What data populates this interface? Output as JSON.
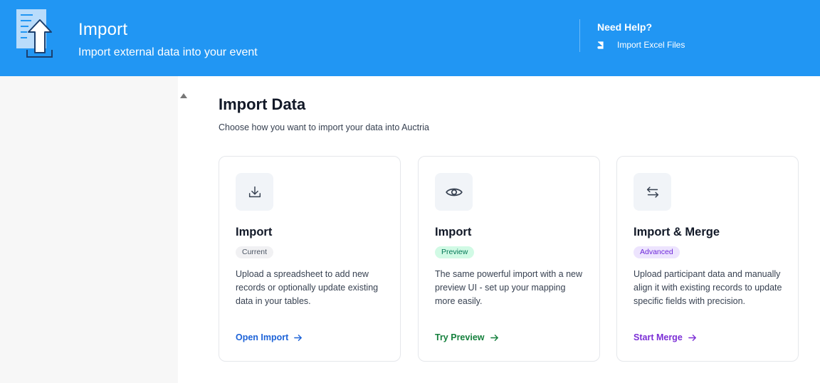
{
  "header": {
    "title": "Import",
    "subtitle": "Import external data into your event",
    "background_color": "#2196f3",
    "icon": "upload-document-icon"
  },
  "help": {
    "title": "Need Help?",
    "link_label": "Import Excel Files",
    "link_icon": "book-icon"
  },
  "main": {
    "title": "Import Data",
    "description": "Choose how you want to import your data into Auctria"
  },
  "cards": [
    {
      "icon": "download-icon",
      "title": "Import",
      "badge": "Current",
      "description": "Upload a spreadsheet to add new records or optionally update existing data in your tables.",
      "link_label": "Open Import",
      "link_color": "#1d63d8"
    },
    {
      "icon": "eye-icon",
      "title": "Import",
      "badge": "Preview",
      "description": "The same powerful import with a new preview UI - set up your mapping more easily.",
      "link_label": "Try Preview",
      "link_color": "#15803d"
    },
    {
      "icon": "swap-arrows-icon",
      "title": "Import & Merge",
      "badge": "Advanced",
      "description": "Upload participant data and manually align it with existing records to update specific fields with precision.",
      "link_label": "Start Merge",
      "link_color": "#7c2fd6"
    }
  ]
}
